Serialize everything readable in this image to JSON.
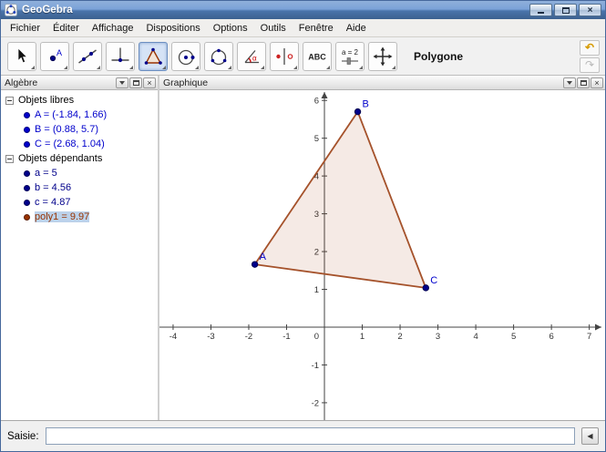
{
  "window": {
    "title": "GeoGebra"
  },
  "menubar": {
    "items": [
      "Fichier",
      "Éditer",
      "Affichage",
      "Dispositions",
      "Options",
      "Outils",
      "Fenêtre",
      "Aide"
    ]
  },
  "toolbar": {
    "caption": "Polygone",
    "selected_index": 4,
    "tools": [
      {
        "icon": "move-cursor-icon"
      },
      {
        "icon": "point-tool-icon",
        "label": "A"
      },
      {
        "icon": "line-two-points-icon"
      },
      {
        "icon": "perpendicular-line-icon"
      },
      {
        "icon": "polygon-tool-icon",
        "selected": true
      },
      {
        "icon": "circle-center-point-icon"
      },
      {
        "icon": "circle-points-icon"
      },
      {
        "icon": "angle-tool-icon",
        "label": "α"
      },
      {
        "icon": "reflect-about-line-icon"
      },
      {
        "icon": "text-tool-icon",
        "label": "ABC"
      },
      {
        "icon": "slider-tool-icon",
        "label": "a = 2"
      },
      {
        "icon": "move-view-icon"
      }
    ]
  },
  "icons": {
    "close": "×",
    "undo": "↶",
    "redo": "↷",
    "input_help": "◀"
  },
  "algebra": {
    "title": "Algèbre",
    "groups": [
      {
        "label": "Objets libres",
        "items": [
          {
            "text": "A = (-1.84, 1.66)",
            "color": "#0000CC"
          },
          {
            "text": "B = (0.88, 5.7)",
            "color": "#0000CC"
          },
          {
            "text": "C = (2.68, 1.04)",
            "color": "#0000CC"
          }
        ]
      },
      {
        "label": "Objets dépendants",
        "items": [
          {
            "text": "a = 5",
            "color": "#00008B"
          },
          {
            "text": "b = 4.56",
            "color": "#00008B"
          },
          {
            "text": "c = 4.87",
            "color": "#00008B"
          },
          {
            "text": "poly1 = 9.97",
            "color": "#993300",
            "selected": true
          }
        ]
      }
    ]
  },
  "graphics": {
    "title": "Graphique",
    "view": {
      "xmin": -4.36,
      "xmax": 7.37,
      "ymin": -2.46,
      "ymax": 6.27
    },
    "x_ticks": [
      -4,
      -3,
      -2,
      -1,
      1,
      2,
      3,
      4,
      5,
      6,
      7
    ],
    "y_ticks": [
      -2,
      -1,
      1,
      2,
      3,
      4,
      5,
      6
    ],
    "origin_label": "0",
    "axis_color": "#444444",
    "tick_color": "#333333",
    "point_color": "#00008B",
    "point_outline": "#000050",
    "point_label_color": "#0000CC",
    "polygon": {
      "name": "poly1",
      "vertices": [
        [
          -1.84,
          1.66
        ],
        [
          0.88,
          5.7
        ],
        [
          2.68,
          1.04
        ]
      ],
      "stroke": "#A5522B",
      "fill": "#993300",
      "fill_opacity": 0.1
    },
    "points": [
      {
        "label": "A",
        "x": -1.84,
        "y": 1.66
      },
      {
        "label": "B",
        "x": 0.88,
        "y": 5.7
      },
      {
        "label": "C",
        "x": 2.68,
        "y": 1.04
      }
    ]
  },
  "inputbar": {
    "label": "Saisie:",
    "value": ""
  }
}
